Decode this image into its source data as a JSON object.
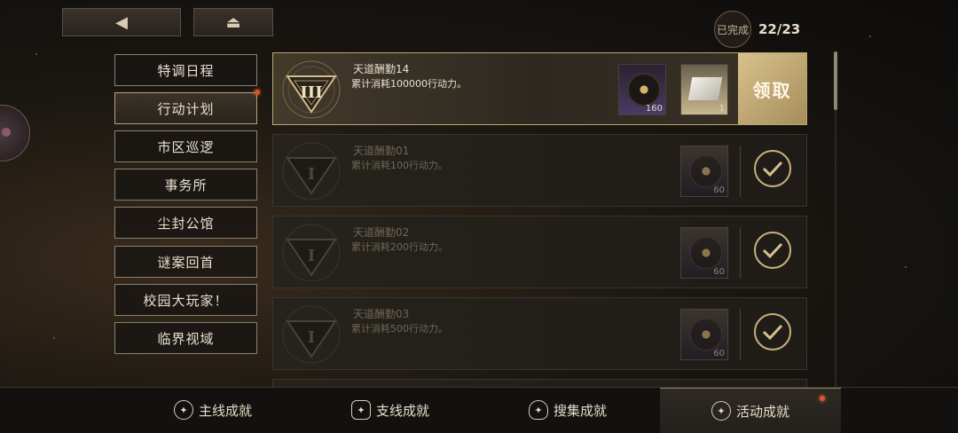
{
  "top": {
    "back_icon": "◀",
    "home_icon": "⏏",
    "completed_label": "已完成",
    "completed_count": "22/23"
  },
  "categories": [
    {
      "label": "特调日程",
      "active": false
    },
    {
      "label": "行动计划",
      "active": true,
      "badge": true
    },
    {
      "label": "市区巡逻",
      "active": false
    },
    {
      "label": "事务所",
      "active": false
    },
    {
      "label": "尘封公馆",
      "active": false
    },
    {
      "label": "谜案回首",
      "active": false
    },
    {
      "label": "校园大玩家！",
      "active": false
    },
    {
      "label": "临界视域",
      "active": false
    }
  ],
  "achievements": [
    {
      "title": "天道酬勤14",
      "desc": "累计消耗100000行动力。",
      "state": "claimable",
      "emblem": "III",
      "rewards": [
        {
          "icon": "record-disc-icon",
          "qty": "160"
        },
        {
          "icon": "paper-ticket-icon",
          "qty": "1"
        }
      ],
      "claim_label": "领取"
    },
    {
      "title": "天道酬勤01",
      "desc": "累计消耗100行动力。",
      "state": "done",
      "emblem": "I",
      "rewards": [
        {
          "icon": "record-disc-icon",
          "qty": "60"
        }
      ]
    },
    {
      "title": "天道酬勤02",
      "desc": "累计消耗200行动力。",
      "state": "done",
      "emblem": "I",
      "rewards": [
        {
          "icon": "record-disc-icon",
          "qty": "60"
        }
      ]
    },
    {
      "title": "天道酬勤03",
      "desc": "累计消耗500行动力。",
      "state": "done",
      "emblem": "I",
      "rewards": [
        {
          "icon": "record-disc-icon",
          "qty": "60"
        }
      ]
    }
  ],
  "tabs": [
    {
      "label": "主线成就",
      "active": false
    },
    {
      "label": "支线成就",
      "active": false
    },
    {
      "label": "搜集成就",
      "active": false
    },
    {
      "label": "活动成就",
      "active": true,
      "badge": true
    }
  ]
}
